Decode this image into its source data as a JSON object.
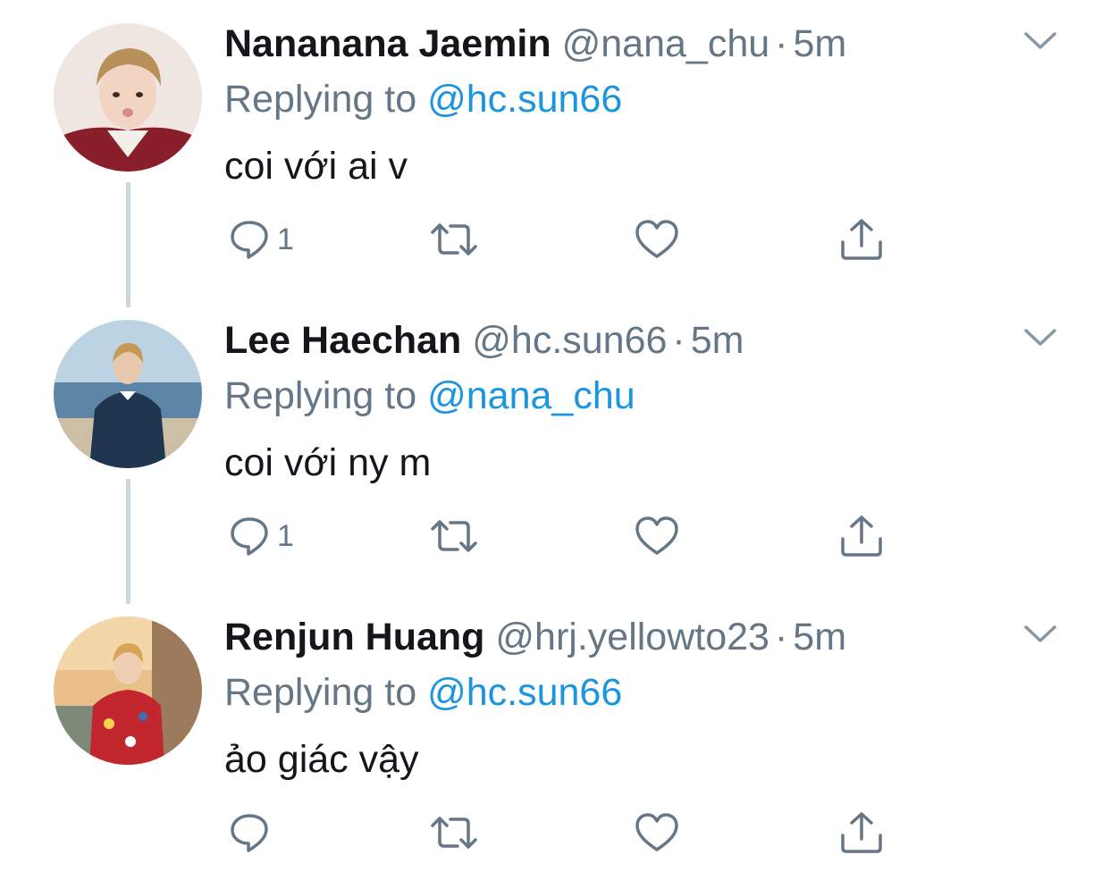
{
  "tweets": [
    {
      "name": "Nananana Jaemin",
      "handle": "@nana_chu",
      "separator": "·",
      "time": "5m",
      "replying_prefix": "Replying to",
      "replying_to": "@hc.sun66",
      "text": "coi với ai v",
      "reply_count": "1",
      "avatar_icon": "avatar-photo",
      "caret_icon": "chevron-down-icon"
    },
    {
      "name": "Lee Haechan",
      "handle": "@hc.sun66",
      "separator": "·",
      "time": "5m",
      "replying_prefix": "Replying to",
      "replying_to": "@nana_chu",
      "text": "coi với ny m",
      "reply_count": "1",
      "avatar_icon": "avatar-photo",
      "caret_icon": "chevron-down-icon"
    },
    {
      "name": "Renjun Huang",
      "handle": "@hrj.yellowto23",
      "separator": "·",
      "time": "5m",
      "replying_prefix": "Replying to",
      "replying_to": "@hc.sun66",
      "text": "ảo giác vậy",
      "reply_count": "",
      "avatar_icon": "avatar-photo",
      "caret_icon": "chevron-down-icon"
    }
  ],
  "colors": {
    "text_primary": "#14171a",
    "text_secondary": "#657786",
    "mention": "#1b95e0",
    "thread_line": "#ccd6dd"
  },
  "action_icons": [
    "reply-icon",
    "retweet-icon",
    "like-icon",
    "share-icon"
  ]
}
